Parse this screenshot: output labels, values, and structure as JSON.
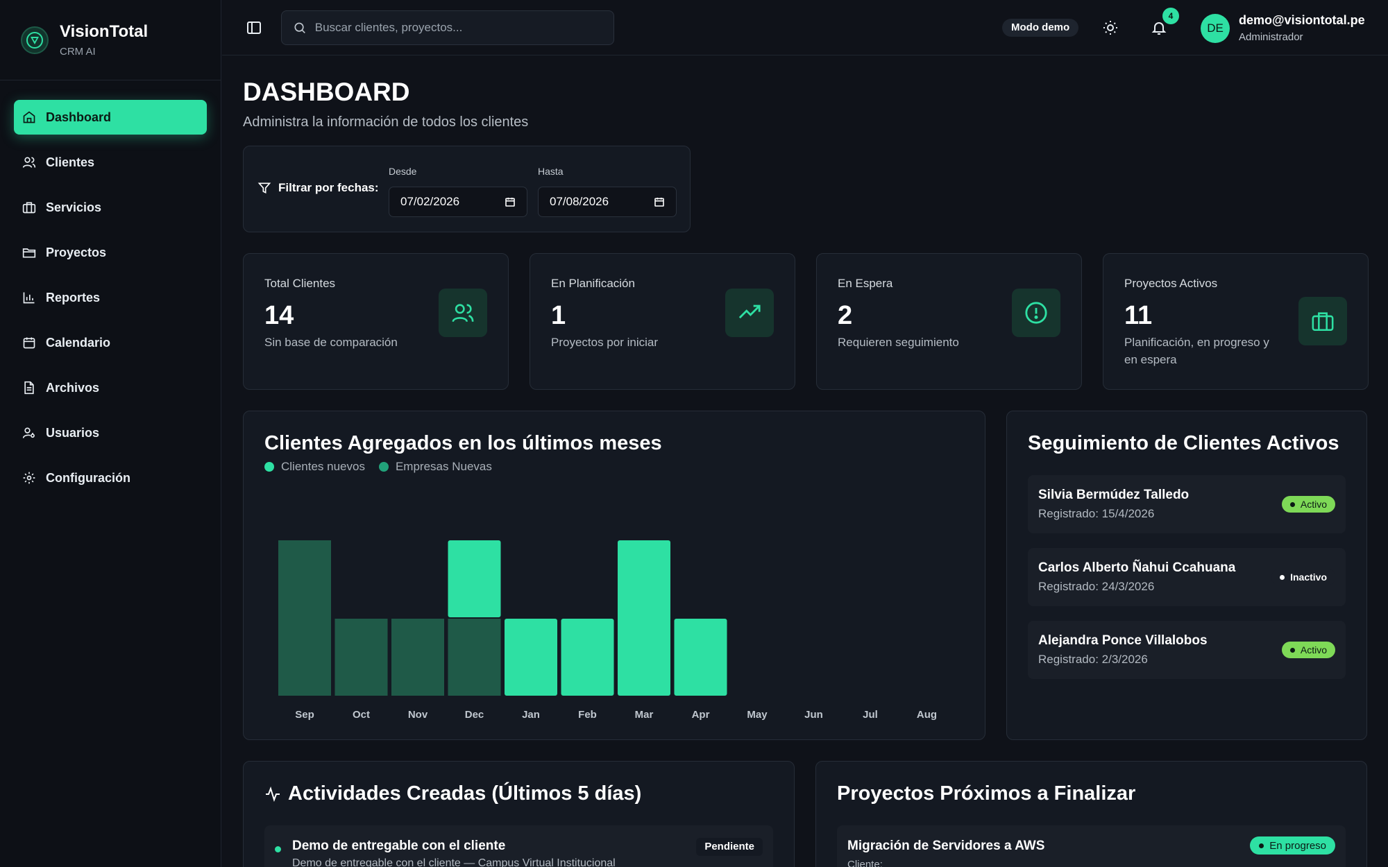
{
  "brand": {
    "name": "VisionTotal",
    "subtitle": "CRM AI"
  },
  "sidebar": {
    "items": [
      {
        "label": "Dashboard",
        "icon": "home-icon",
        "active": true
      },
      {
        "label": "Clientes",
        "icon": "users-icon"
      },
      {
        "label": "Servicios",
        "icon": "briefcase-icon"
      },
      {
        "label": "Proyectos",
        "icon": "folder-icon"
      },
      {
        "label": "Reportes",
        "icon": "bar-chart-icon"
      },
      {
        "label": "Calendario",
        "icon": "calendar-icon"
      },
      {
        "label": "Archivos",
        "icon": "file-icon"
      },
      {
        "label": "Usuarios",
        "icon": "user-key-icon"
      },
      {
        "label": "Configuración",
        "icon": "gear-icon"
      }
    ]
  },
  "topbar": {
    "search_placeholder": "Buscar clientes, proyectos...",
    "demo_badge": "Modo demo",
    "notification_count": "4",
    "avatar_initials": "DE",
    "user_email": "demo@visiontotal.pe",
    "user_role": "Administrador"
  },
  "header": {
    "title": "DASHBOARD",
    "subtitle": "Administra la información de todos los clientes"
  },
  "filter": {
    "label": "Filtrar por fechas:",
    "from_label": "Desde",
    "from_value": "07/02/2026",
    "to_label": "Hasta",
    "to_value": "07/08/2026"
  },
  "stats": [
    {
      "label": "Total Clientes",
      "value": "14",
      "desc": "Sin base de comparación",
      "icon": "users-icon"
    },
    {
      "label": "En Planificación",
      "value": "1",
      "desc": "Proyectos por iniciar",
      "icon": "trending-up-icon"
    },
    {
      "label": "En Espera",
      "value": "2",
      "desc": "Requieren seguimiento",
      "icon": "alert-circle-icon"
    },
    {
      "label": "Proyectos Activos",
      "value": "11",
      "desc": "Planificación, en progreso y en espera",
      "icon": "briefcase-icon"
    }
  ],
  "chart_title": "Clientes Agregados en los últimos meses",
  "chart_data": {
    "type": "bar",
    "stacked": true,
    "title": "Clientes Agregados en los últimos meses",
    "categories": [
      "Sep",
      "Oct",
      "Nov",
      "Dec",
      "Jan",
      "Feb",
      "Mar",
      "Apr",
      "May",
      "Jun",
      "Jul",
      "Aug"
    ],
    "series": [
      {
        "name": "Clientes nuevos",
        "color": "#2ee0a3",
        "values": [
          0,
          0,
          0,
          1,
          1,
          1,
          2,
          1,
          0,
          0,
          0,
          0
        ]
      },
      {
        "name": "Empresas Nuevas",
        "color": "#1f5a48",
        "values": [
          2,
          1,
          1,
          1,
          0,
          0,
          0,
          0,
          0,
          0,
          0,
          0
        ]
      }
    ],
    "legend": "top-left",
    "grid": false
  },
  "follow": {
    "title": "Seguimiento de Clientes Activos",
    "clients": [
      {
        "name": "Silvia Bermúdez Talledo",
        "date": "Registrado: 15/4/2026",
        "status": "Activo"
      },
      {
        "name": "Carlos Alberto Ñahui Ccahuana",
        "date": "Registrado: 24/3/2026",
        "status": "Inactivo"
      },
      {
        "name": "Alejandra Ponce Villalobos",
        "date": "Registrado: 2/3/2026",
        "status": "Activo"
      }
    ]
  },
  "activities": {
    "title": "Actividades Creadas (Últimos 5 días)",
    "items": [
      {
        "title": "Demo de entregable con el cliente",
        "sub": "Demo de entregable con el cliente — Campus Virtual Institucional",
        "status": "Pendiente"
      }
    ]
  },
  "projects": {
    "title": "Proyectos Próximos a Finalizar",
    "items": [
      {
        "title": "Migración de Servidores a AWS",
        "sub": "Cliente:",
        "status": "En progreso"
      }
    ]
  },
  "colors": {
    "accent": "#2ee0a3",
    "accent_dark": "#1f5a48",
    "active_green": "#7ed957",
    "background": "#0f1219",
    "card": "#141922"
  }
}
